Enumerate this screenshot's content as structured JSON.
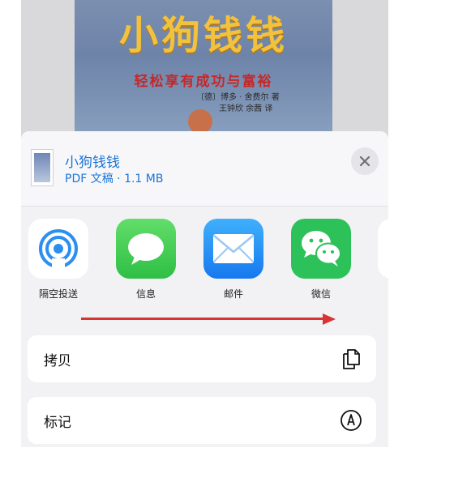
{
  "preview": {
    "book_title": "小狗钱钱",
    "book_subtitle": "轻松享有成功与富裕",
    "book_author_line1": "〔德〕博多 · 舍费尔 著",
    "book_author_line2": "王钟欣  余茜 译"
  },
  "share_header": {
    "document_name": "小狗钱钱",
    "document_meta": "PDF 文稿 · 1.1 MB"
  },
  "apps": [
    {
      "label": "隔空投送",
      "icon": "airdrop-icon"
    },
    {
      "label": "信息",
      "icon": "messages-icon"
    },
    {
      "label": "邮件",
      "icon": "mail-icon"
    },
    {
      "label": "微信",
      "icon": "wechat-icon"
    }
  ],
  "actions": [
    {
      "label": "拷贝",
      "icon": "copy-icon"
    },
    {
      "label": "标记",
      "icon": "markup-icon"
    }
  ],
  "colors": {
    "accent_blue": "#1c75d8",
    "messages_green": "#3cc84a",
    "mail_blue": "#1f8ef5",
    "wechat_green": "#2dc15a",
    "arrow_red": "#d83434"
  }
}
